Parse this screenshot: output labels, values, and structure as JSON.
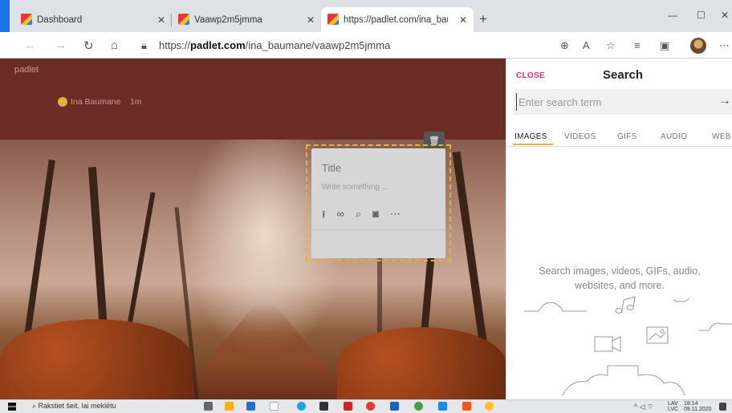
{
  "browser": {
    "tabs": [
      {
        "label": "Dashboard"
      },
      {
        "label": "Vaawp2m5jmma"
      },
      {
        "label": "https://padlet.com/ina_baumane"
      }
    ],
    "address": {
      "prefix": "https://",
      "domain": "padlet.com",
      "path": "/ina_baumane/vaawp2m5jmma"
    }
  },
  "padlet": {
    "brand": "padlet",
    "author": "Ina Baumane",
    "separator": "·",
    "time": "1m"
  },
  "card": {
    "title_placeholder": "Title",
    "body_placeholder": "Write something ..."
  },
  "search_panel": {
    "close": "CLOSE",
    "title": "Search",
    "placeholder": "Enter search term",
    "tabs": [
      "IMAGES",
      "VIDEOS",
      "GIFS",
      "AUDIO",
      "WEB"
    ],
    "active_tab": "IMAGES",
    "hint": "Search images, videos, GIFs, audio, websites, and more."
  },
  "taskbar": {
    "search_text": "Rakstiet šeit, lai meklētu",
    "lang": "LAV",
    "lang2": "LVC",
    "time": "18:14",
    "date": "09.11.2020"
  },
  "colors": {
    "header": "#6b2c26",
    "accent": "#e2336b",
    "tab_underline": "#e9b23a"
  }
}
